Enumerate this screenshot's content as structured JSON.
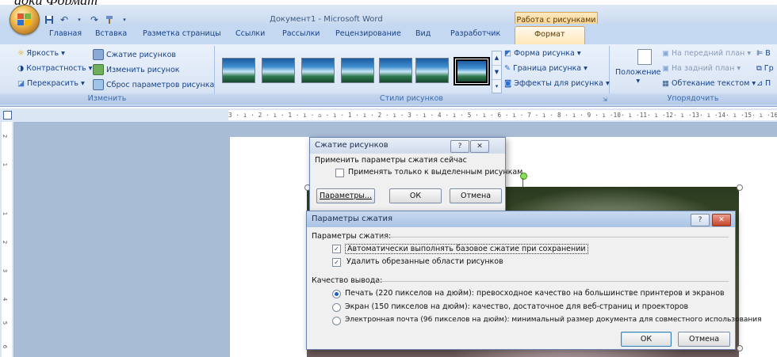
{
  "caption": "адки Формат",
  "titlebar": {
    "doc_title": "Документ1 - Microsoft Word",
    "context_tab_header": "Работа с рисунками"
  },
  "tabs": [
    "Главная",
    "Вставка",
    "Разметка страницы",
    "Ссылки",
    "Рассылки",
    "Рецензирование",
    "Вид",
    "Разработчик"
  ],
  "active_tab": "Формат",
  "ribbon": {
    "change_group": {
      "label": "Изменить",
      "brightness": "Яркость",
      "contrast": "Контрастность",
      "recolor": "Перекрасить",
      "compress": "Сжатие рисунков",
      "change_picture": "Изменить рисунок",
      "reset_picture": "Сброс параметров рисунка"
    },
    "styles_group": {
      "label": "Стили рисунков",
      "shape": "Форма рисунка",
      "border": "Граница рисунка",
      "effects": "Эффекты для рисунка"
    },
    "arrange_group": {
      "label": "Упорядочить",
      "position": "Положение",
      "bring_front": "На передний план",
      "send_back": "На задний план",
      "text_wrap": "Обтекание текстом",
      "cut1": "В",
      "cut2": "Гр",
      "cut3": "П"
    }
  },
  "ruler": {
    "ticks": "3 · ı · 2 · ı · 1 · ı · ⌂ · ı · 1 · ı · 2 · ı · 3 · ı · 4 · ı · 5 · ı · 6 · ı · 7 · ı · 8 · ı · 9 · ı ·10· ı ·11· ı ·12· ı ·13· ı ·14· ı ·15· ı ·16· △ ·17· ı",
    "v_ticks": [
      "2",
      "1",
      "1",
      "2",
      "3",
      "4",
      "5",
      "6"
    ]
  },
  "compress_dialog": {
    "title": "Сжатие рисунков",
    "section": "Применить параметры сжатия сейчас",
    "only_selected": "Применять только к выделенным рисункам",
    "params_button": "Параметры...",
    "ok_button": "ОК",
    "cancel_button": "Отмена",
    "help": "?",
    "close": "✕"
  },
  "params_dialog": {
    "title": "Параметры сжатия",
    "section1": "Параметры сжатия:",
    "auto_compress": "Автоматически выполнять базовое сжатие при сохранении",
    "delete_cropped": "Удалить обрезанные области рисунков",
    "section2": "Качество вывода:",
    "print": "Печать (220 пикселов на дюйм): превосходное качество на большинстве принтеров и экранов",
    "screen": "Экран (150 пикселов на дюйм): качество, достаточное для веб-страниц и проекторов",
    "email": "Электронная почта (96 пикселов на дюйм): минимальный размер документа для совместного использования",
    "ok_button": "ОК",
    "cancel_button": "Отмена",
    "help": "?",
    "close": "✕"
  }
}
